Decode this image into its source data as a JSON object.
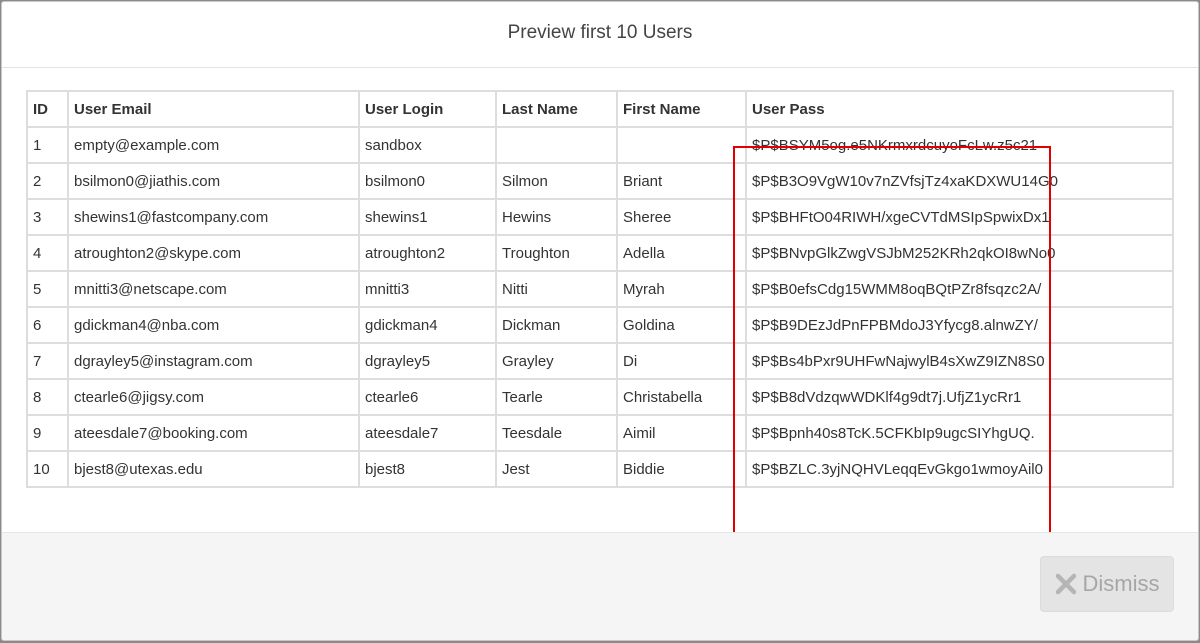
{
  "modal": {
    "title": "Preview first 10 Users",
    "dismiss_label": "Dismiss",
    "dismiss_icon": "close-x-icon"
  },
  "table": {
    "headers": [
      "ID",
      "User Email",
      "User Login",
      "Last Name",
      "First Name",
      "User Pass"
    ],
    "rows": [
      [
        "1",
        "empty@example.com",
        "sandbox",
        "",
        "",
        "$P$BSYM5og.e5NKrmxrdcuyoFcLw.z5c21"
      ],
      [
        "2",
        "bsilmon0@jiathis.com",
        "bsilmon0",
        "Silmon",
        "Briant",
        "$P$B3O9VgW10v7nZVfsjTz4xaKDXWU14G0"
      ],
      [
        "3",
        "shewins1@fastcompany.com",
        "shewins1",
        "Hewins",
        "Sheree",
        "$P$BHFtO04RIWH/xgeCVTdMSIpSpwixDx1"
      ],
      [
        "4",
        "atroughton2@skype.com",
        "atroughton2",
        "Troughton",
        "Adella",
        "$P$BNvpGlkZwgVSJbM252KRh2qkOI8wNo0"
      ],
      [
        "5",
        "mnitti3@netscape.com",
        "mnitti3",
        "Nitti",
        "Myrah",
        "$P$B0efsCdg15WMM8oqBQtPZr8fsqzc2A/"
      ],
      [
        "6",
        "gdickman4@nba.com",
        "gdickman4",
        "Dickman",
        "Goldina",
        "$P$B9DEzJdPnFPBMdoJ3Yfycg8.alnwZY/"
      ],
      [
        "7",
        "dgrayley5@instagram.com",
        "dgrayley5",
        "Grayley",
        "Di",
        "$P$Bs4bPxr9UHFwNajwylB4sXwZ9IZN8S0"
      ],
      [
        "8",
        "ctearle6@jigsy.com",
        "ctearle6",
        "Tearle",
        "Christabella",
        "$P$B8dVdzqwWDKlf4g9dt7j.UfjZ1ycRr1"
      ],
      [
        "9",
        "ateesdale7@booking.com",
        "ateesdale7",
        "Teesdale",
        "Aimil",
        "$P$Bpnh40s8TcK.5CFKbIp9ugcSIYhgUQ."
      ],
      [
        "10",
        "bjest8@utexas.edu",
        "bjest8",
        "Jest",
        "Biddie",
        "$P$BZLC.3yjNQHVLeqqEvGkgo1wmoyAil0"
      ]
    ]
  },
  "colors": {
    "highlight_border": "#e00000",
    "footer_background": "#f5f5f5",
    "button_text": "#a6a6a6"
  }
}
